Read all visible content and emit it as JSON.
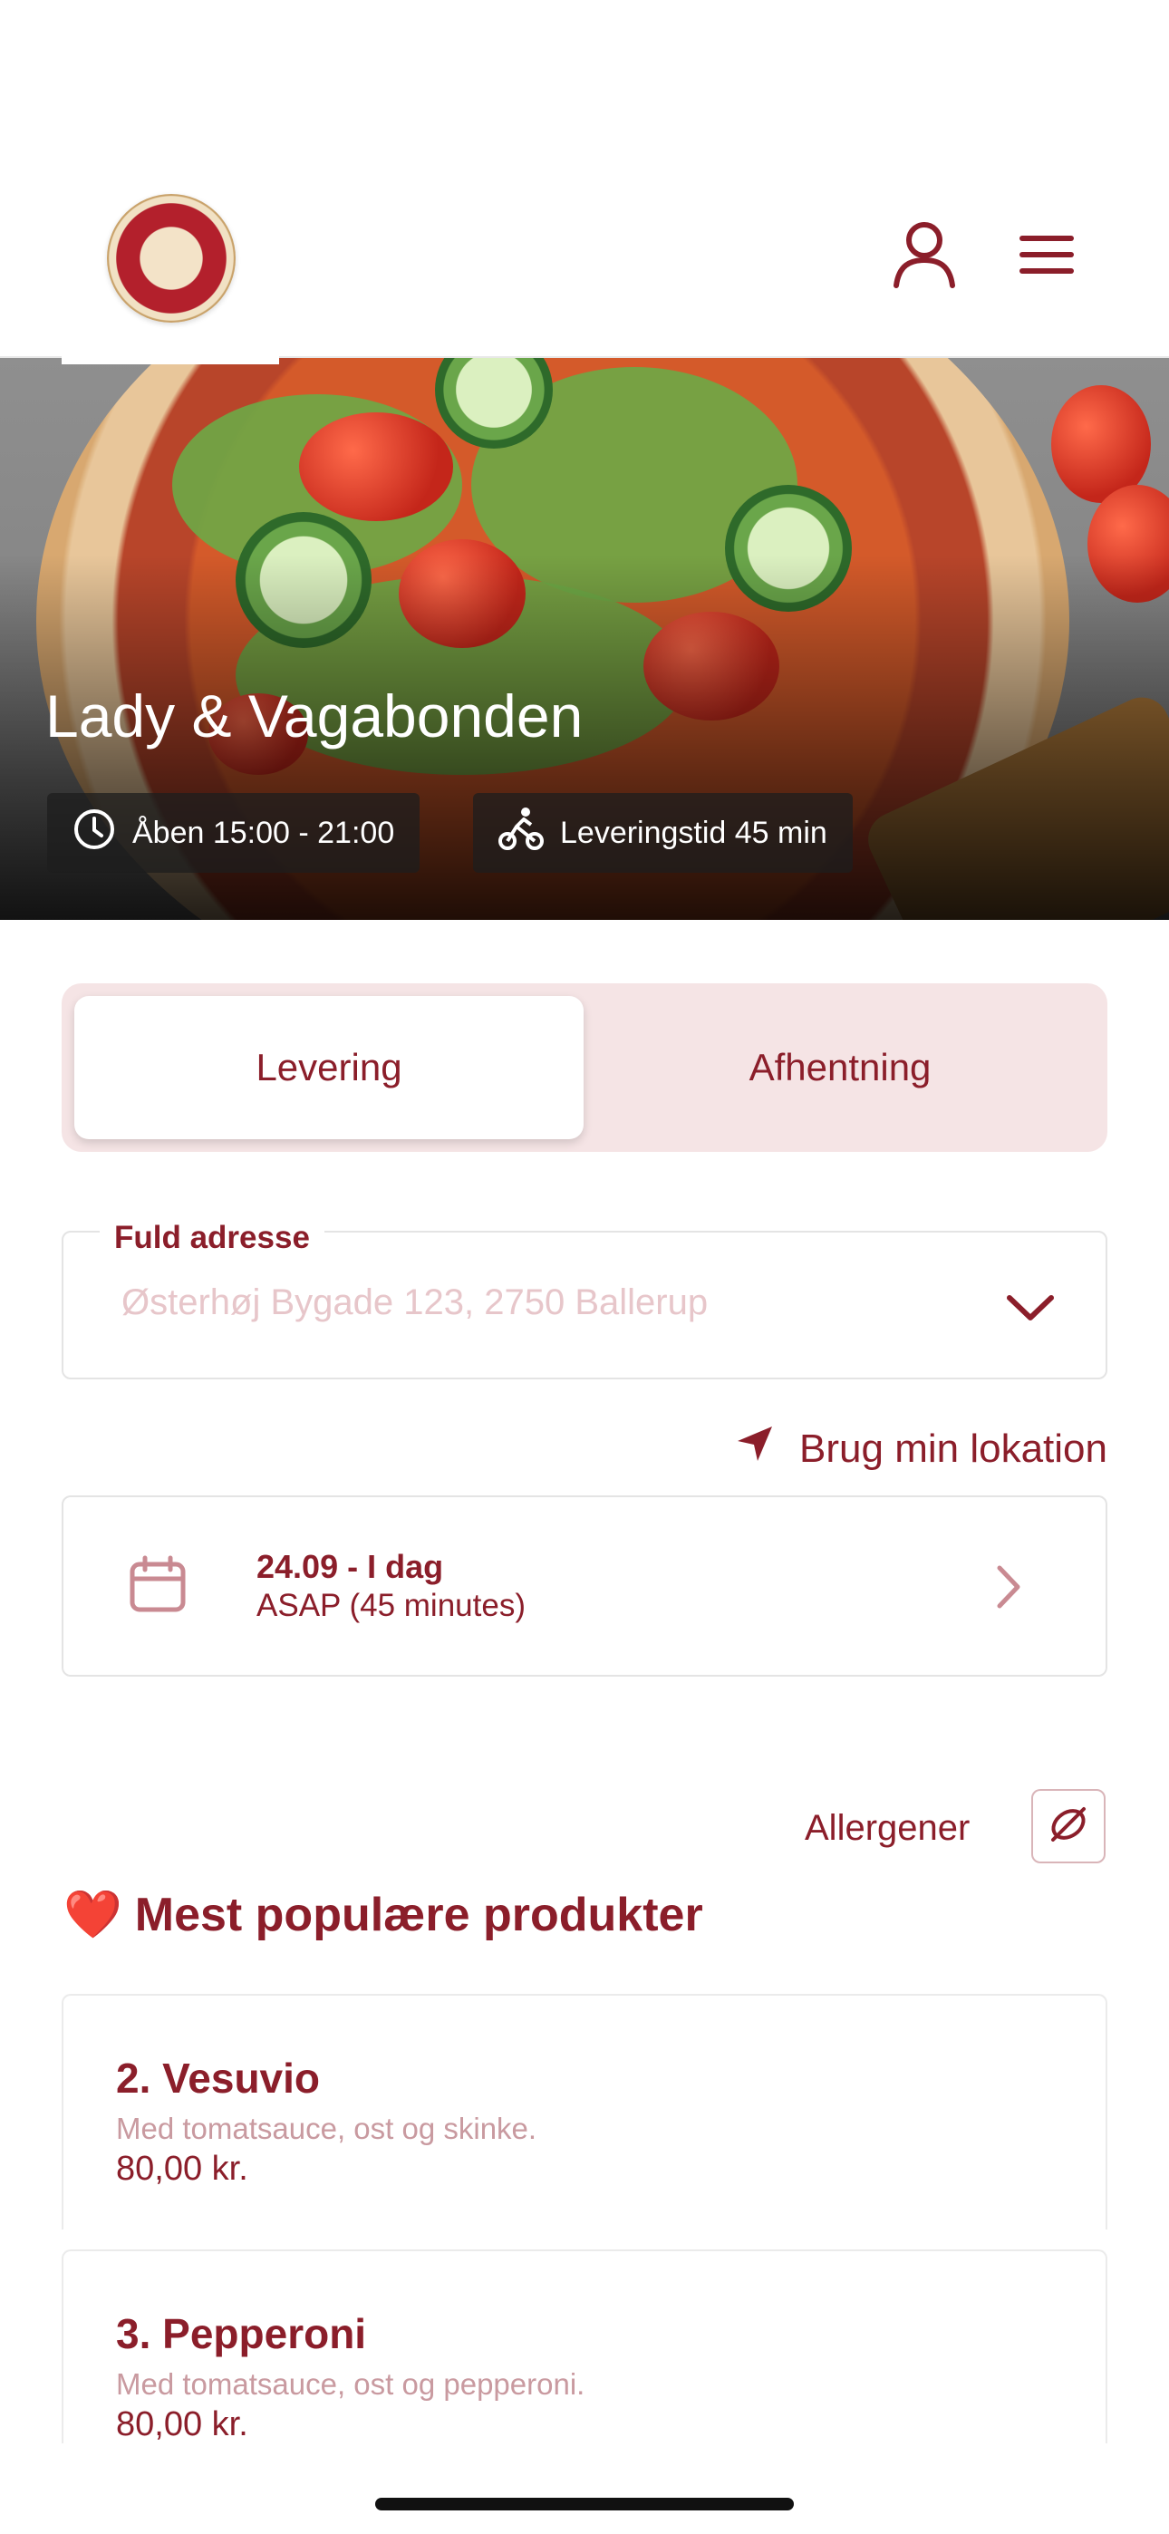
{
  "header": {
    "logo_name": "logo",
    "icons": [
      "person-icon",
      "hamburger-menu-icon"
    ]
  },
  "hero": {
    "title": "Lady & Vagabonden",
    "opening_hours": "Åben 15:00 - 21:00",
    "delivery_time": "Leveringstid 45 min"
  },
  "order_type": {
    "tabs": [
      "Levering",
      "Afhentning"
    ],
    "selected": "Levering"
  },
  "address": {
    "label": "Fuld adresse",
    "placeholder": "Østerhøj Bygade 123, 2750 Ballerup",
    "value": ""
  },
  "location_link": "Brug min lokation",
  "schedule": {
    "date": "24.09 - I dag",
    "time": "ASAP (45 minutes)"
  },
  "allergens_label": "Allergener",
  "section": {
    "emoji": "❤️",
    "title": "Mest populære produkter"
  },
  "products": [
    {
      "name": "2. Vesuvio",
      "description": "Med tomatsauce, ost og skinke.",
      "price": "80,00 kr."
    },
    {
      "name": "3. Pepperoni",
      "description": "Med tomatsauce, ost og pepperoni.",
      "price": "80,00 kr."
    }
  ],
  "colors": {
    "brand": "#8b1e2a",
    "segment_bg": "#f5e4e5",
    "muted_text": "#c99aa0"
  }
}
